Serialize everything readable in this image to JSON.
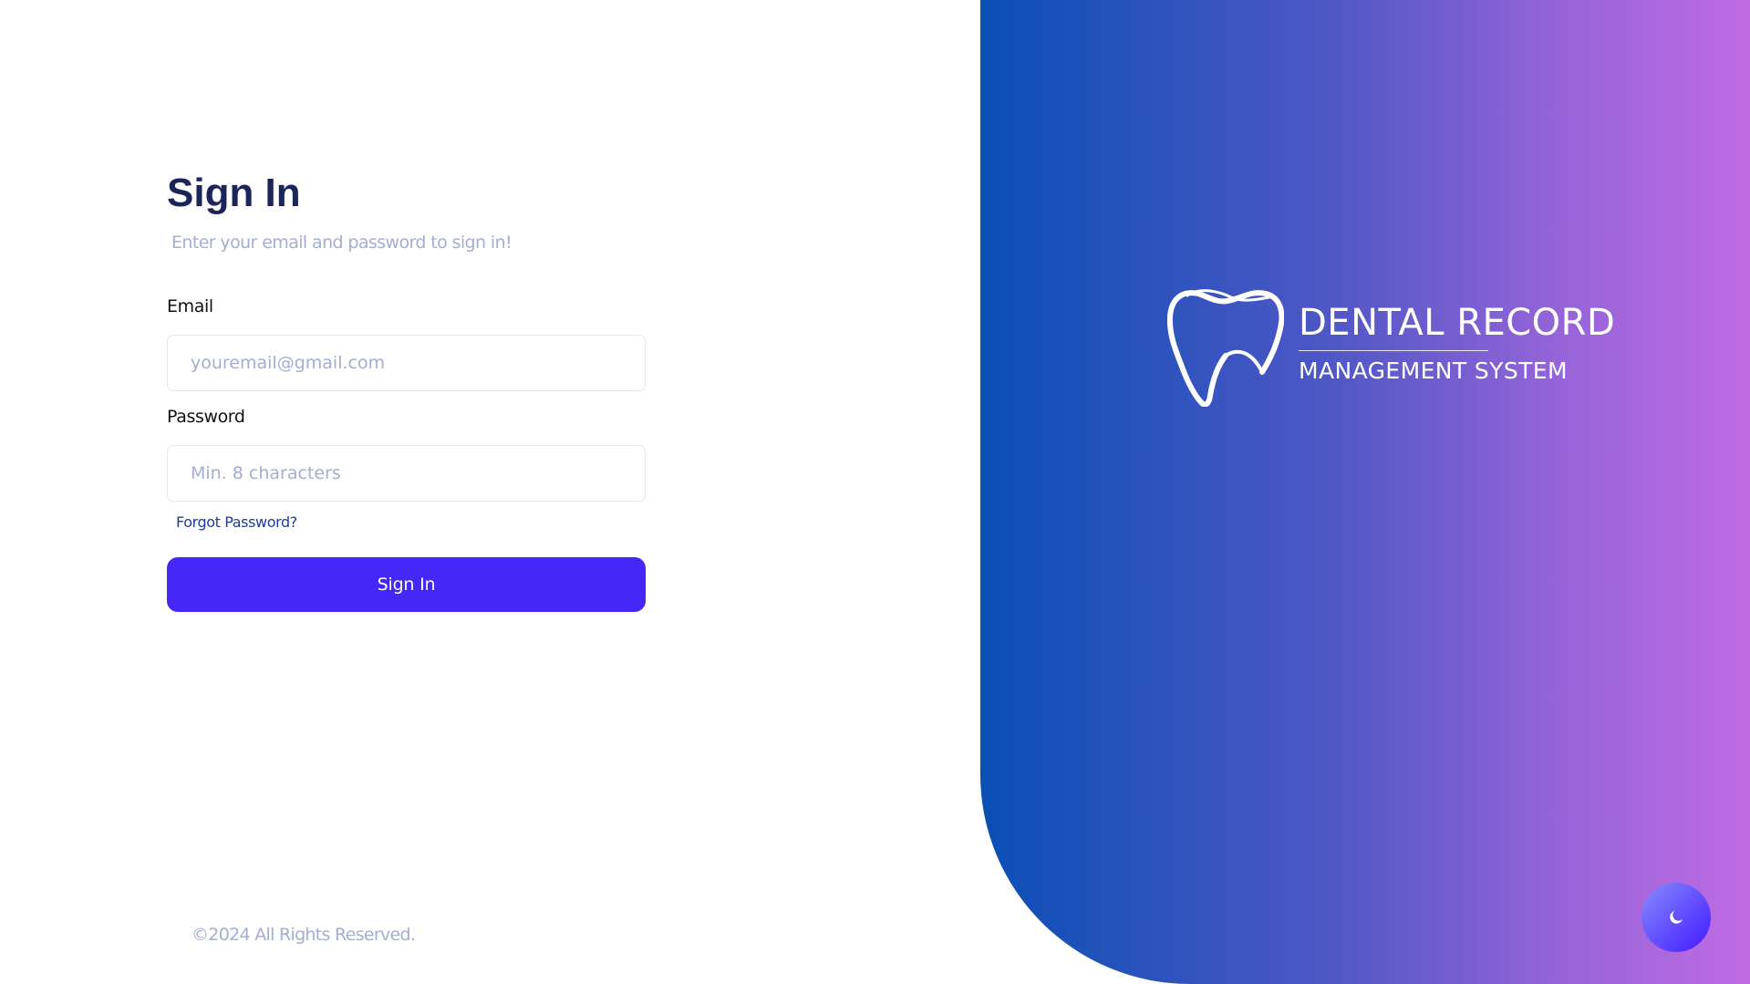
{
  "signin": {
    "title": "Sign In",
    "subtitle": "Enter your email and password to sign in!",
    "email_label": "Email",
    "email_placeholder": "youremail@gmail.com",
    "email_value": "",
    "password_label": "Password",
    "password_placeholder": "Min. 8 characters",
    "password_value": "",
    "forgot_link": "Forgot Password?",
    "submit_label": "Sign In"
  },
  "footer": {
    "copyright": "©2024 All Rights Reserved."
  },
  "brand": {
    "name_line1": "DENTAL RECORD",
    "name_line2": "MANAGEMENT SYSTEM",
    "logo_icon": "tooth-logo-icon",
    "gradient_start": "#0a4fb4",
    "gradient_end": "#c06be3"
  },
  "theme_toggle": {
    "icon": "moon-icon"
  },
  "colors": {
    "accent": "#4527f7",
    "heading": "#1b2559",
    "muted": "#a3aed0",
    "link": "#1a3c9c"
  }
}
